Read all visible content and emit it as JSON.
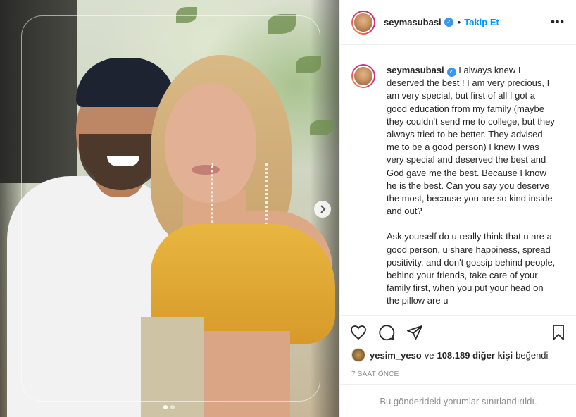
{
  "post": {
    "photo_alt": "Photo of a man in a cap and a woman in a yellow top",
    "carousel": {
      "total": 2,
      "active_index": 0
    }
  },
  "header": {
    "username": "seymasubasi",
    "verified": true,
    "bullet": "•",
    "follow_label": "Takip Et",
    "more_label": "•••"
  },
  "caption": {
    "username": "seymasubasi",
    "paragraph1": "I always knew I deserved the best ! I am very precious, I am very special, but first of all I got a good education from my family (maybe they couldn't send me to college, but they always tried to be better. They advised me to be a good person) I knew I was very special and deserved the best and God gave me the best. Because I know he is the best. Can you say you deserve the most, because you are so kind inside and out?",
    "paragraph2": "Ask yourself do u really think that u are a good person, u share happiness, spread positivity, and don't gossip behind people, behind your friends, take care of your family first, when you put your head on the pillow are u"
  },
  "likes": {
    "first_liker": "yesim_yeso",
    "connector": "ve",
    "others": "108.189 diğer kişi",
    "suffix": "beğendi"
  },
  "timestamp": "7 SAAT ÖNCE",
  "comments_notice": "Bu gönderideki yorumlar sınırlandırıldı.",
  "colors": {
    "accent": "#0095f6",
    "verified": "#3897f0",
    "text": "#262626",
    "muted": "#8e8e8e",
    "border": "#efefef"
  },
  "icons": [
    "heart-icon",
    "comment-icon",
    "share-icon",
    "bookmark-icon",
    "chevron-right-icon",
    "verified-icon"
  ]
}
